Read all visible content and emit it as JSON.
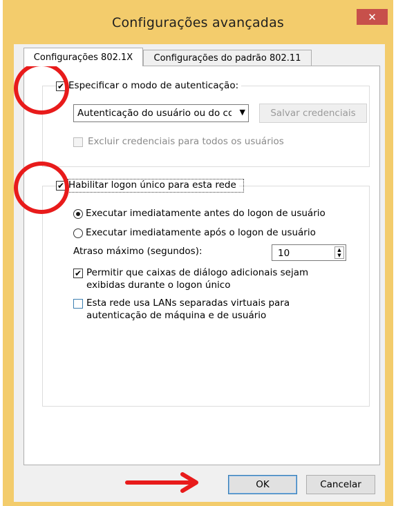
{
  "window": {
    "title": "Configurações avançadas",
    "close_glyph": "✕"
  },
  "tabs": [
    {
      "label": "Configurações 802.1X",
      "active": true
    },
    {
      "label": "Configurações do padrão 802.11",
      "active": false
    }
  ],
  "auth_group": {
    "specify_mode_label": "Especificar o modo de autenticação:",
    "specify_mode_checked": true,
    "mode_select_value": "Autenticação do usuário ou do co",
    "save_credentials_label": "Salvar credenciais",
    "exclude_credentials_label": "Excluir credenciais para todos os usuários",
    "exclude_credentials_checked": false
  },
  "sso_group": {
    "enable_sso_label": "Habilitar logon único para esta rede",
    "enable_sso_checked": true,
    "radio_before_label": "Executar imediatamente antes do logon de usuário",
    "radio_after_label": "Executar imediatamente após o logon de usuário",
    "selected_radio": "before",
    "max_delay_label": "Atraso máximo (segundos):",
    "max_delay_value": "10",
    "allow_dialogs_label_line1": "Permitir que caixas de diálogo adicionais sejam",
    "allow_dialogs_label_line2": "exibidas durante o logon único",
    "allow_dialogs_checked": true,
    "vlan_label_line1": "Esta rede usa LANs separadas virtuais para",
    "vlan_label_line2": "autenticação de máquina e de usuário",
    "vlan_checked": false
  },
  "footer": {
    "ok_label": "OK",
    "cancel_label": "Cancelar"
  },
  "glyphs": {
    "check": "✔",
    "dropdown": "▼",
    "spin_up": "▲",
    "spin_down": "▼"
  },
  "colors": {
    "frame": "#f3cc6c",
    "close_button": "#c7504b",
    "annotation": "#e81b1b",
    "focus_blue": "#3c7fb1"
  }
}
